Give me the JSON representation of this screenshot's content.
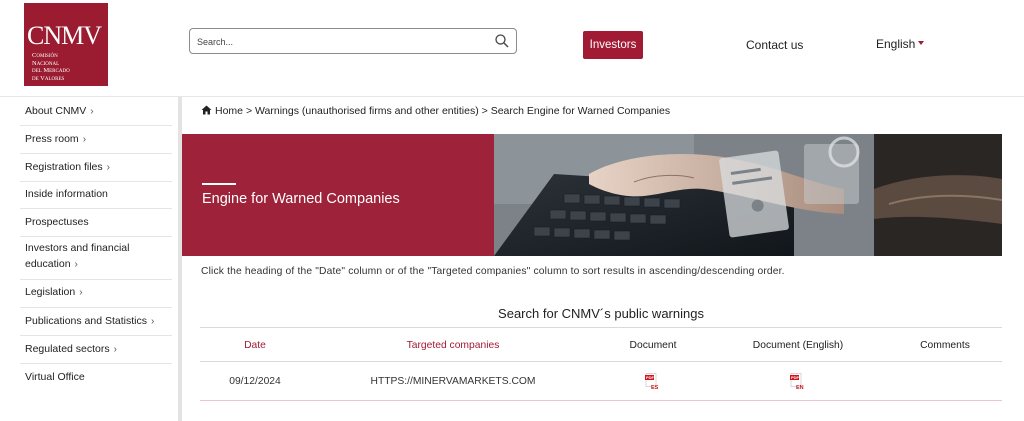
{
  "header": {
    "logo": {
      "mark": "CNMV",
      "lines": [
        "Comisión",
        "Nacional",
        "del Mercado",
        "de Valores"
      ]
    },
    "search": {
      "placeholder": "Search..."
    },
    "nav": {
      "investors": "Investors",
      "contact": "Contact us",
      "language": "English"
    }
  },
  "sidebar": {
    "items": [
      {
        "label": "About CNMV",
        "chevron": "›"
      },
      {
        "label": "Press room",
        "chevron": "›"
      },
      {
        "label": "Registration files",
        "chevron": "›"
      },
      {
        "label": "Inside information",
        "chevron": ""
      },
      {
        "label": "Prospectuses",
        "chevron": ""
      },
      {
        "label_line1": "Investors and financial",
        "label_line2": "education",
        "chevron": "›"
      },
      {
        "label": "Legislation",
        "chevron": "›"
      },
      {
        "label": "Publications and Statistics",
        "chevron": "›"
      },
      {
        "label": "Regulated sectors",
        "chevron": "›"
      },
      {
        "label": "Virtual Office",
        "chevron": ""
      }
    ]
  },
  "breadcrumb": {
    "home": "Home",
    "separator": ">",
    "items": [
      "Warnings (unauthorised firms and other entities)",
      "Search Engine for Warned Companies"
    ]
  },
  "hero": {
    "title": "Engine for Warned Companies"
  },
  "hint": "Click the heading of the \"Date\" column or of the \"Targeted companies\" column to sort results in ascending/descending order.",
  "table": {
    "title": "Search for CNMV´s public warnings",
    "headers": {
      "date": "Date",
      "companies": "Targeted companies",
      "document": "Document",
      "document_en": "Document (English)",
      "comments": "Comments"
    },
    "rows": [
      {
        "date": "09/12/2024",
        "company": "HTTPS://MINERVAMARKETS.COM",
        "doc_lang": "ES",
        "doc_en_lang": "EN",
        "comments": ""
      }
    ]
  },
  "colors": {
    "brand": "#a21b35",
    "hero": "#9e2239"
  }
}
